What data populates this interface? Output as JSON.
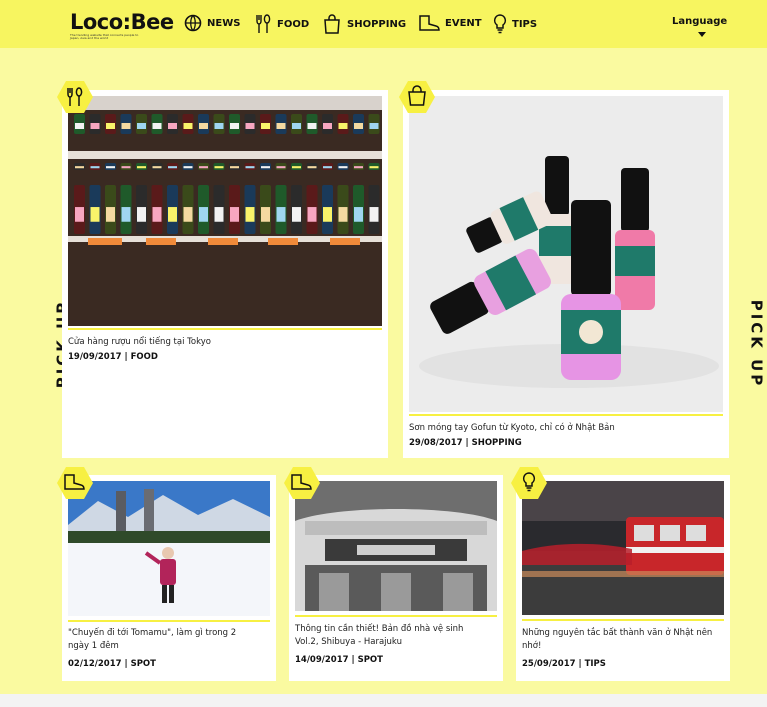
{
  "header": {
    "logo_text": "Loco:Bee",
    "logo_tagline": "The trending website that connects people to Japan, Asia and the world",
    "nav": [
      {
        "label": "NEWS",
        "icon": "globe-icon"
      },
      {
        "label": "FOOD",
        "icon": "fork-spoon-icon"
      },
      {
        "label": "SHOPPING",
        "icon": "shopping-bag-icon"
      },
      {
        "label": "EVENT",
        "icon": "boot-icon"
      },
      {
        "label": "TIPS",
        "icon": "lightbulb-icon"
      }
    ],
    "language": "Language"
  },
  "side_label": "PICK UP",
  "cards": [
    {
      "title": "Cửa hàng rượu nổi tiếng tại Tokyo",
      "date": "19/09/2017",
      "category": "FOOD",
      "icon": "fork-spoon-icon"
    },
    {
      "title": "Sơn móng tay Gofun từ Kyoto, chỉ có ở Nhật Bản",
      "date": "29/08/2017",
      "category": "SHOPPING",
      "icon": "shopping-bag-icon"
    },
    {
      "title_line1": "\"Chuyến đi tới Tomamu\", làm gì trong 2",
      "title_line2": "ngày 1 đêm",
      "date": "02/12/2017",
      "category": "SPOT",
      "icon": "boot-icon"
    },
    {
      "title_line1": "Thông tin cần thiết! Bản đồ nhà vệ sinh",
      "title_line2": "Vol.2, Shibuya - Harajuku",
      "date": "14/09/2017",
      "category": "SPOT",
      "icon": "boot-icon"
    },
    {
      "title_line1": "Những nguyên tắc bất thành văn ở Nhật nên",
      "title_line2": "nhớ!",
      "date": "25/09/2017",
      "category": "TIPS",
      "icon": "lightbulb-icon"
    }
  ],
  "separator": "|",
  "colors": {
    "brand_yellow": "#f7f560",
    "page_bg": "#fafaa0",
    "badge_yellow": "#f7f042"
  }
}
